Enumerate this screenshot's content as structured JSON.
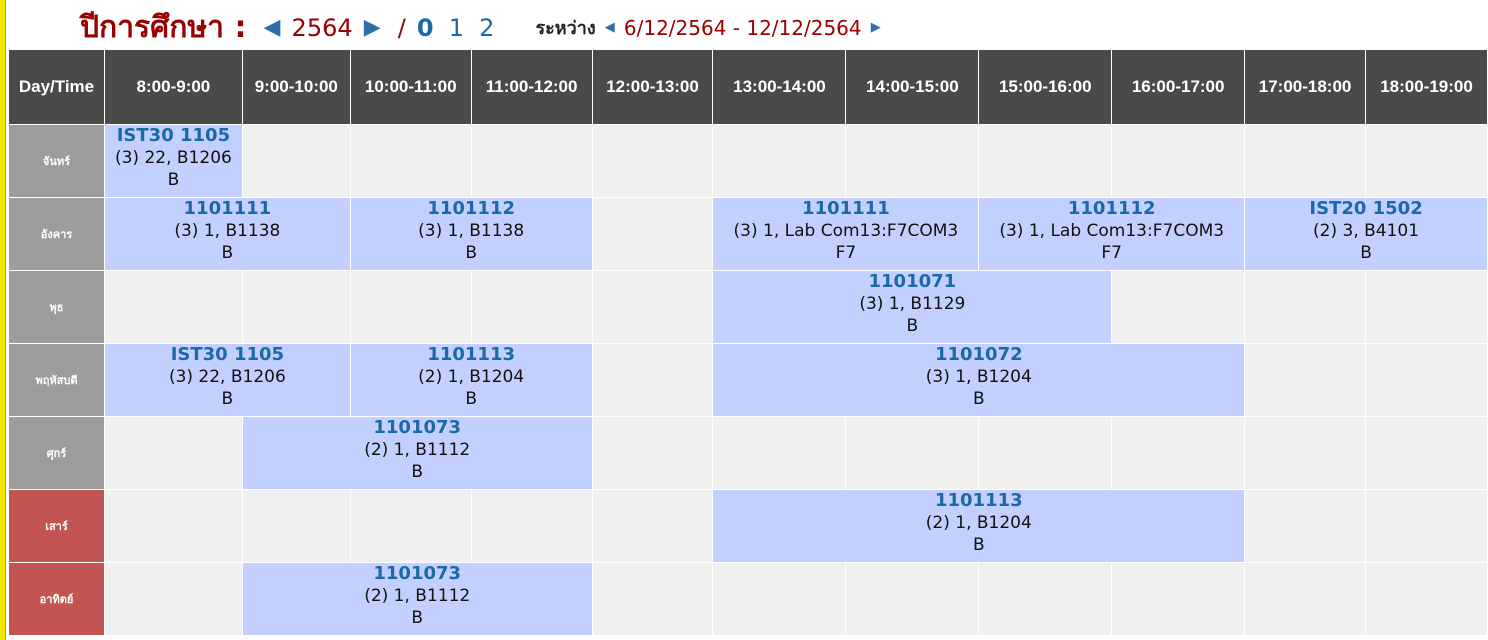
{
  "header": {
    "year_label": "ปีการศึกษา :",
    "year": "2564",
    "slash": "/",
    "semesters": [
      "0",
      "1",
      "2"
    ],
    "between_label": "ระหว่าง",
    "date_range": "6/12/2564 - 12/12/2564"
  },
  "timetable": {
    "corner": "Day/Time",
    "time_slots": [
      "8:00-9:00",
      "9:00-10:00",
      "10:00-11:00",
      "11:00-12:00",
      "12:00-13:00",
      "13:00-14:00",
      "14:00-15:00",
      "15:00-16:00",
      "16:00-17:00",
      "17:00-18:00",
      "18:00-19:00"
    ],
    "days": [
      "จันทร์",
      "อังคาร",
      "พุธ",
      "พฤหัสบดี",
      "ศุกร์",
      "เสาร์",
      "อาทิตย์"
    ],
    "sessions": {
      "mon_1": {
        "code": "IST30 1105",
        "info": "(3) 22, B1206",
        "building": "B"
      },
      "tue_1": {
        "code": "1101111",
        "info": "(3) 1, B1138",
        "building": "B"
      },
      "tue_2": {
        "code": "1101112",
        "info": "(3) 1, B1138",
        "building": "B"
      },
      "tue_3": {
        "code": "1101111",
        "info": "(3) 1, Lab Com13:F7COM3",
        "building": "F7"
      },
      "tue_4": {
        "code": "1101112",
        "info": "(3) 1, Lab Com13:F7COM3",
        "building": "F7"
      },
      "tue_5": {
        "code": "IST20 1502",
        "info": "(2) 3, B4101",
        "building": "B"
      },
      "wed_1": {
        "code": "1101071",
        "info": "(3) 1, B1129",
        "building": "B"
      },
      "thu_1": {
        "code": "IST30 1105",
        "info": "(3) 22, B1206",
        "building": "B"
      },
      "thu_2": {
        "code": "1101113",
        "info": "(2) 1, B1204",
        "building": "B"
      },
      "thu_3": {
        "code": "1101072",
        "info": "(3) 1, B1204",
        "building": "B"
      },
      "fri_1": {
        "code": "1101073",
        "info": "(2) 1, B1112",
        "building": "B"
      },
      "sat_1": {
        "code": "1101113",
        "info": "(2) 1, B1204",
        "building": "B"
      },
      "sun_1": {
        "code": "1101073",
        "info": "(2) 1, B1112",
        "building": "B"
      }
    }
  },
  "colors": {
    "title": "#990000",
    "accent": "#1a6aa8",
    "header_bg": "#4a4a4a",
    "weekday_bg": "#9c9c9c",
    "weekend_bg": "#c25451",
    "session_bg": "#c3cffe",
    "empty_bg": "#f0f0f0"
  },
  "icons": [
    "triangle-left-icon",
    "triangle-right-icon"
  ]
}
